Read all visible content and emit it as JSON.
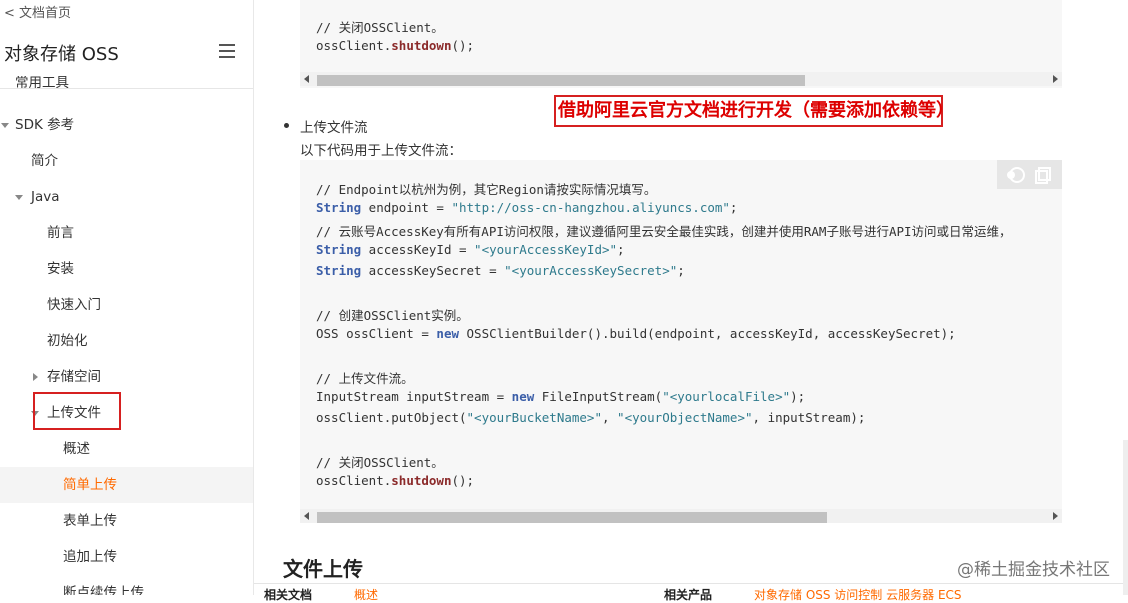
{
  "sidebar": {
    "back_link": "< 文档首页",
    "title": "对象存储 OSS",
    "items": [
      {
        "label": "常用工具"
      },
      {
        "label": "SDK 参考"
      },
      {
        "label": "简介"
      },
      {
        "label": "Java"
      },
      {
        "label": "前言"
      },
      {
        "label": "安装"
      },
      {
        "label": "快速入门"
      },
      {
        "label": "初始化"
      },
      {
        "label": "存储空间"
      },
      {
        "label": "上传文件"
      },
      {
        "label": "概述"
      },
      {
        "label": "简单上传"
      },
      {
        "label": "表单上传"
      },
      {
        "label": "追加上传"
      },
      {
        "label": "断点续传上传"
      }
    ]
  },
  "top_code": {
    "lines": [
      "// 关闭OSSClient。",
      "ossClient.",
      "shutdown",
      "();"
    ]
  },
  "annotation": "借助阿里云官方文档进行开发（需要添加依赖等）",
  "bullet_title": "上传文件流",
  "bullet_desc": "以下代码用于上传文件流：",
  "code": {
    "c1": "// Endpoint以杭州为例，其它Region请按实际情况填写。",
    "l2a": "String",
    "l2b": " endpoint = ",
    "l2c": "\"http://oss-cn-hangzhou.aliyuncs.com\"",
    "l2d": ";",
    "c3": "// 云账号AccessKey有所有API访问权限，建议遵循阿里云安全最佳实践，创建并使用RAM子账号进行API访问或日常运维，",
    "l4a": "String",
    "l4b": " accessKeyId = ",
    "l4c": "\"<yourAccessKeyId>\"",
    "l4d": ";",
    "l5a": "String",
    "l5b": " accessKeySecret = ",
    "l5c": "\"<yourAccessKeySecret>\"",
    "l5d": ";",
    "c6": "// 创建OSSClient实例。",
    "l7a": "OSS ossClient = ",
    "l7b": "new",
    "l7c": " OSSClientBuilder().build(endpoint, accessKeyId, accessKeySecret);",
    "c8": "// 上传文件流。",
    "l9a": "InputStream inputStream = ",
    "l9b": "new",
    "l9c": " FileInputStream(",
    "l9d": "\"<yourlocalFile>\"",
    "l9e": ");",
    "l10a": "ossClient.putObject(",
    "l10b": "\"<yourBucketName>\"",
    "l10c": ", ",
    "l10d": "\"<yourObjectName>\"",
    "l10e": ", inputStream);",
    "c11": "// 关闭OSSClient。",
    "l12a": "ossClient.",
    "l12b": "shutdown",
    "l12c": "();"
  },
  "section_title": "文件上传",
  "footer": {
    "related_docs": "相关文档",
    "overview": "概述",
    "related_products": "相关产品",
    "products": "对象存储 OSS 访问控制 云服务器 ECS"
  },
  "watermark": "@稀土掘金技术社区",
  "colors": {
    "accent": "#ff6a00",
    "annotation": "#d62020"
  }
}
